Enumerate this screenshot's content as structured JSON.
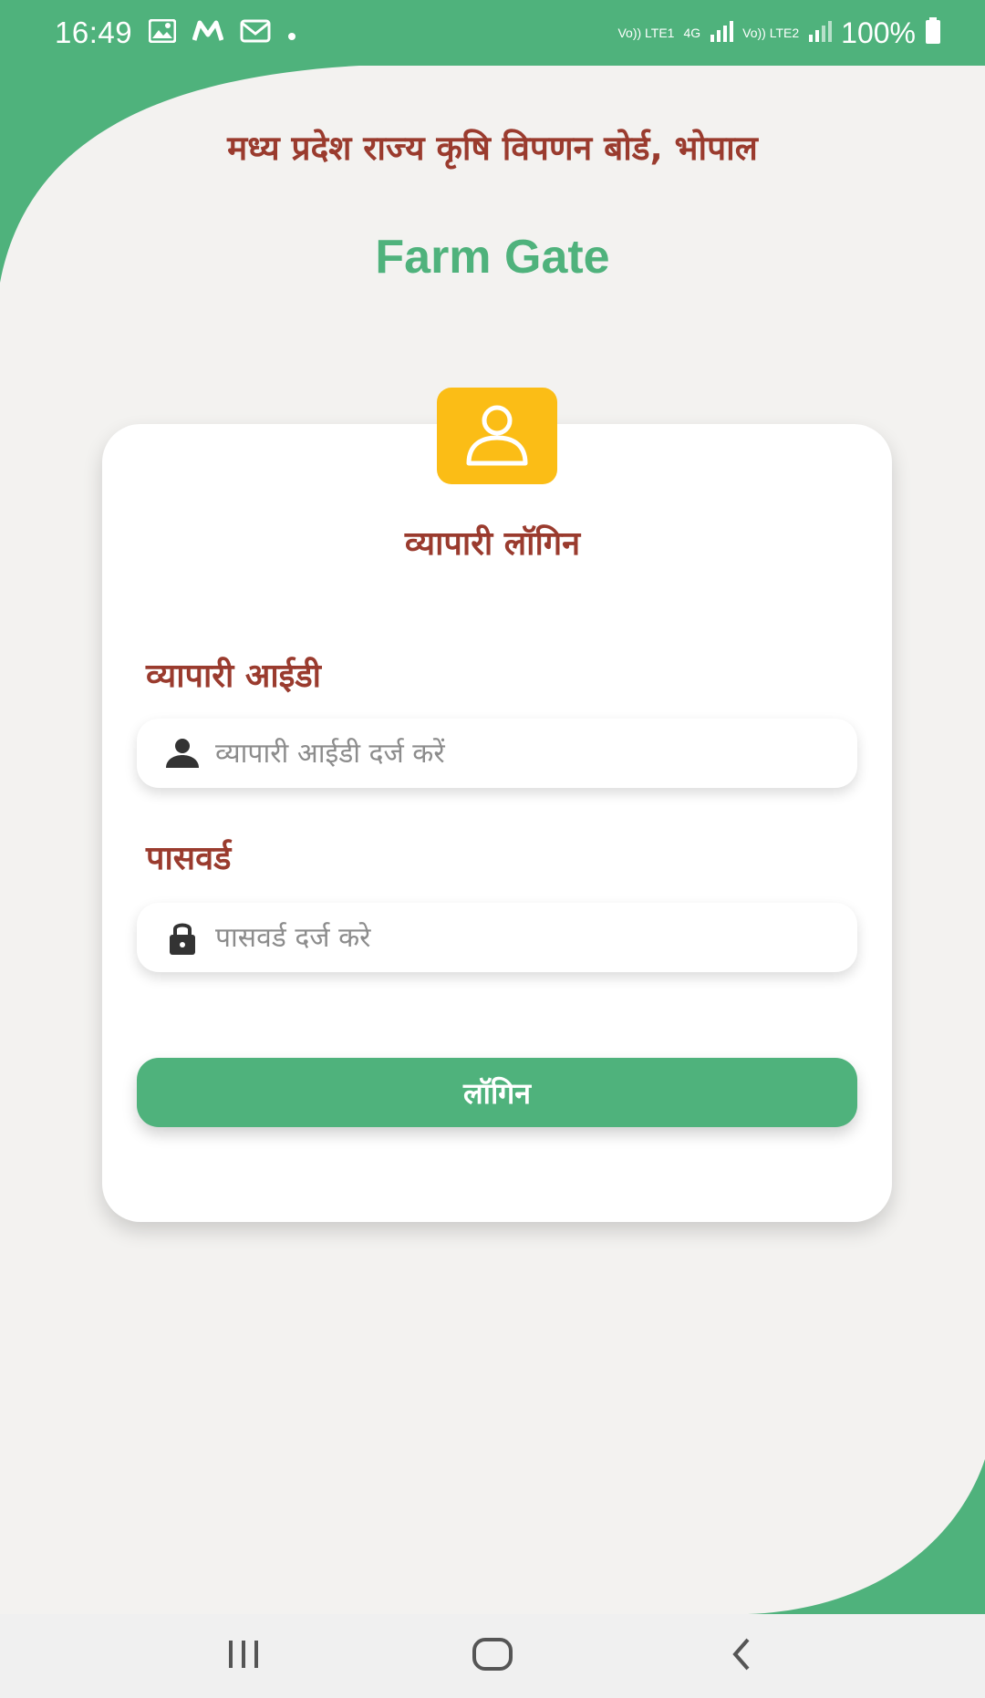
{
  "status_bar": {
    "time": "16:49",
    "net_sim1": "Vo)) LTE1",
    "net_4g": "4G",
    "net_sim2": "Vo)) LTE2",
    "battery": "100%"
  },
  "header": {
    "board_title": "मध्य प्रदेश राज्य कृषि विपणन बोर्ड, भोपाल",
    "app_title": "Farm Gate"
  },
  "login_card": {
    "title": "व्यापारी लॉगिन",
    "user_id_label": "व्यापारी आईडी",
    "user_id_placeholder": "व्यापारी आईडी दर्ज करें",
    "password_label": "पासवर्ड",
    "password_placeholder": "पासवर्ड दर्ज करे",
    "login_button": "लॉगिन"
  },
  "colors": {
    "brand_green": "#4fb27c",
    "title_maroon": "#9a3b2e",
    "badge_yellow": "#fbbd16",
    "background": "#f3f2f0"
  },
  "icons": {
    "badge": "user-outline-icon",
    "user_field": "person-icon",
    "password_field": "lock-icon",
    "nav_recents": "recents-icon",
    "nav_home": "home-icon",
    "nav_back": "back-icon"
  }
}
